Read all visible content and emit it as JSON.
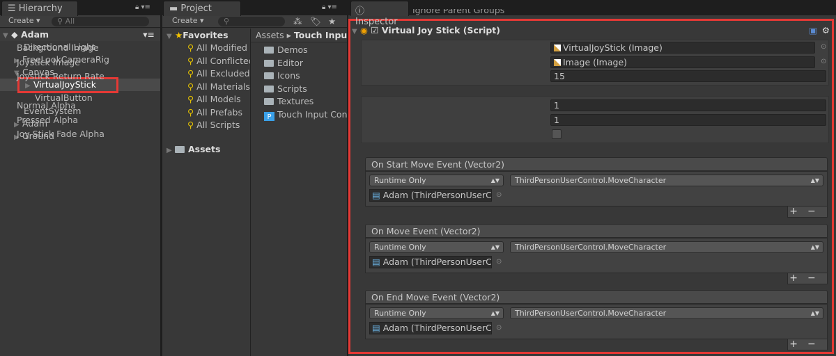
{
  "hierarchy": {
    "tab": "Hierarchy",
    "create": "Create",
    "search_placeholder": "All",
    "scene": "Adam",
    "items": [
      {
        "label": "Directional Light"
      },
      {
        "label": "FreeLookCameraRig"
      },
      {
        "label": "Canvas"
      },
      {
        "label": "VirtualJoyStick"
      },
      {
        "label": "VirtualButton"
      },
      {
        "label": "EventSystem"
      },
      {
        "label": "Adam"
      },
      {
        "label": "Ground"
      }
    ]
  },
  "project": {
    "tab": "Project",
    "create": "Create",
    "favorites": "Favorites",
    "favorite_items": [
      "All Modified",
      "All Conflicted",
      "All Excluded",
      "All Materials",
      "All Models",
      "All Prefabs",
      "All Scripts"
    ],
    "assets": "Assets",
    "breadcrumb": [
      "Assets",
      "Touch Input"
    ],
    "files": [
      "Demos",
      "Editor",
      "Icons",
      "Scripts",
      "Textures",
      "Touch Input Controls"
    ]
  },
  "inspector": {
    "tab": "Inspector",
    "partial_above": "Ignore Parent Groups",
    "component": "Virtual Joy Stick (Script)",
    "fields": [
      {
        "label": "Background Image",
        "value": "VirtualJoyStick (Image)"
      },
      {
        "label": "Joystick Image",
        "value": "Image (Image)"
      },
      {
        "label": "Joystick Return Rate",
        "value": "15"
      }
    ],
    "alpha": [
      {
        "label": "Normal Alpha",
        "value": "1"
      },
      {
        "label": "Pressed Alpha",
        "value": "1"
      },
      {
        "label": "Joy Stick Fade Alpha",
        "checked": false
      }
    ],
    "events": [
      {
        "title": "On Start Move Event (Vector2)",
        "runtime": "Runtime Only",
        "function": "ThirdPersonUserControl.MoveCharacter",
        "target": "Adam (ThirdPersonUserControl)"
      },
      {
        "title": "On Move Event (Vector2)",
        "runtime": "Runtime Only",
        "function": "ThirdPersonUserControl.MoveCharacter",
        "target": "Adam (ThirdPersonUserControl)"
      },
      {
        "title": "On End Move Event (Vector2)",
        "runtime": "Runtime Only",
        "function": "ThirdPersonUserControl.MoveCharacter",
        "target": "Adam (ThirdPersonUserControl)"
      }
    ],
    "plus": "+",
    "minus": "−"
  },
  "highlight_color": "#e53935"
}
